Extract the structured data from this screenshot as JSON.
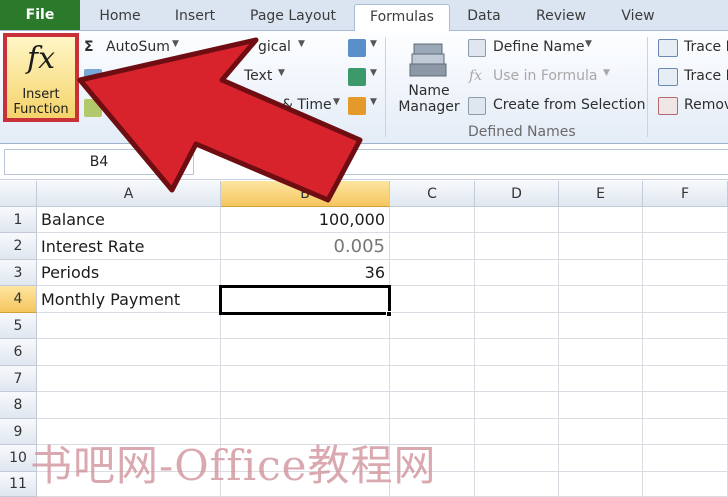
{
  "tabs": [
    {
      "label": "File"
    },
    {
      "label": "Home"
    },
    {
      "label": "Insert"
    },
    {
      "label": "Page Layout"
    },
    {
      "label": "Formulas"
    },
    {
      "label": "Data"
    },
    {
      "label": "Review"
    },
    {
      "label": "View"
    }
  ],
  "active_tab": "Formulas",
  "ribbon": {
    "insert_function": {
      "icon": "fx",
      "line1": "Insert",
      "line2": "Function"
    },
    "function_library": {
      "autosum": "AutoSum",
      "logical": "gical",
      "text": "Text",
      "date_time": "& Time"
    },
    "name_manager": {
      "line1": "Name",
      "line2": "Manager"
    },
    "define_name": "Define Name",
    "use_in_formula": "Use in Formula",
    "create_from_selection": "Create from Selection",
    "defined_names_label": "Defined Names",
    "trace_precedents": "Trace P",
    "trace_dependents": "Trace D",
    "remove_arrows": "Remov"
  },
  "formula_bar": {
    "name_box": "B4",
    "fx_label": "fx",
    "formula": ""
  },
  "sheet": {
    "columns": [
      "A",
      "B",
      "C",
      "D",
      "E",
      "F"
    ],
    "selected_column": "B",
    "rows": [
      {
        "n": "1",
        "a": "Balance",
        "b": "100,000"
      },
      {
        "n": "2",
        "a": "Interest Rate",
        "b": "0.005"
      },
      {
        "n": "3",
        "a": "Periods",
        "b": "36"
      },
      {
        "n": "4",
        "a": "Monthly Payment",
        "b": ""
      },
      {
        "n": "5",
        "a": "",
        "b": ""
      },
      {
        "n": "6",
        "a": "",
        "b": ""
      },
      {
        "n": "7",
        "a": "",
        "b": ""
      },
      {
        "n": "8",
        "a": "",
        "b": ""
      },
      {
        "n": "9",
        "a": "",
        "b": ""
      },
      {
        "n": "10",
        "a": "",
        "b": ""
      },
      {
        "n": "11",
        "a": "",
        "b": ""
      }
    ],
    "active_cell": "B4",
    "selected_row": "4"
  },
  "watermark": "书吧网-Office教程网",
  "colors": {
    "file_tab": "#2b7a2b",
    "highlight_red": "#c8313a",
    "selected_header": "#f5c55e"
  }
}
